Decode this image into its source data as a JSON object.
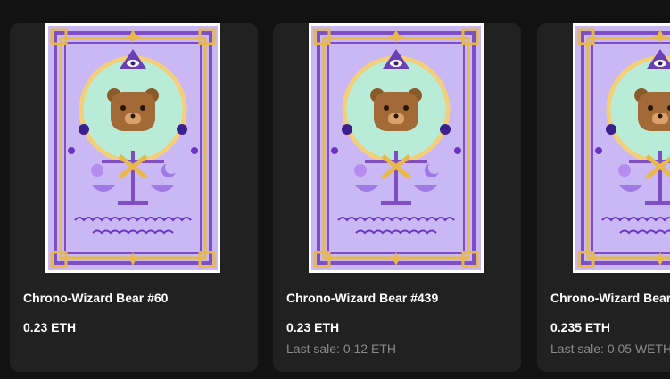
{
  "cards": [
    {
      "title": "Chrono-Wizard Bear #60",
      "price": "0.23 ETH",
      "last_sale": ""
    },
    {
      "title": "Chrono-Wizard Bear #439",
      "price": "0.23 ETH",
      "last_sale": "Last sale: 0.12 ETH"
    },
    {
      "title": "Chrono-Wizard Bear",
      "price": "0.235 ETH",
      "last_sale": "Last sale: 0.05 WETH"
    }
  ],
  "colors": {
    "page_bg": "#121212",
    "card_bg": "#212121",
    "art_bg": "#c9b8f4",
    "art_frame": "#7e4fc4",
    "art_gold": "#e8b84a",
    "bear_brown": "#8a5a2b"
  },
  "icons": [
    "eye-icon",
    "bear-face-icon",
    "scales-icon",
    "star-icon",
    "moon-icon"
  ]
}
